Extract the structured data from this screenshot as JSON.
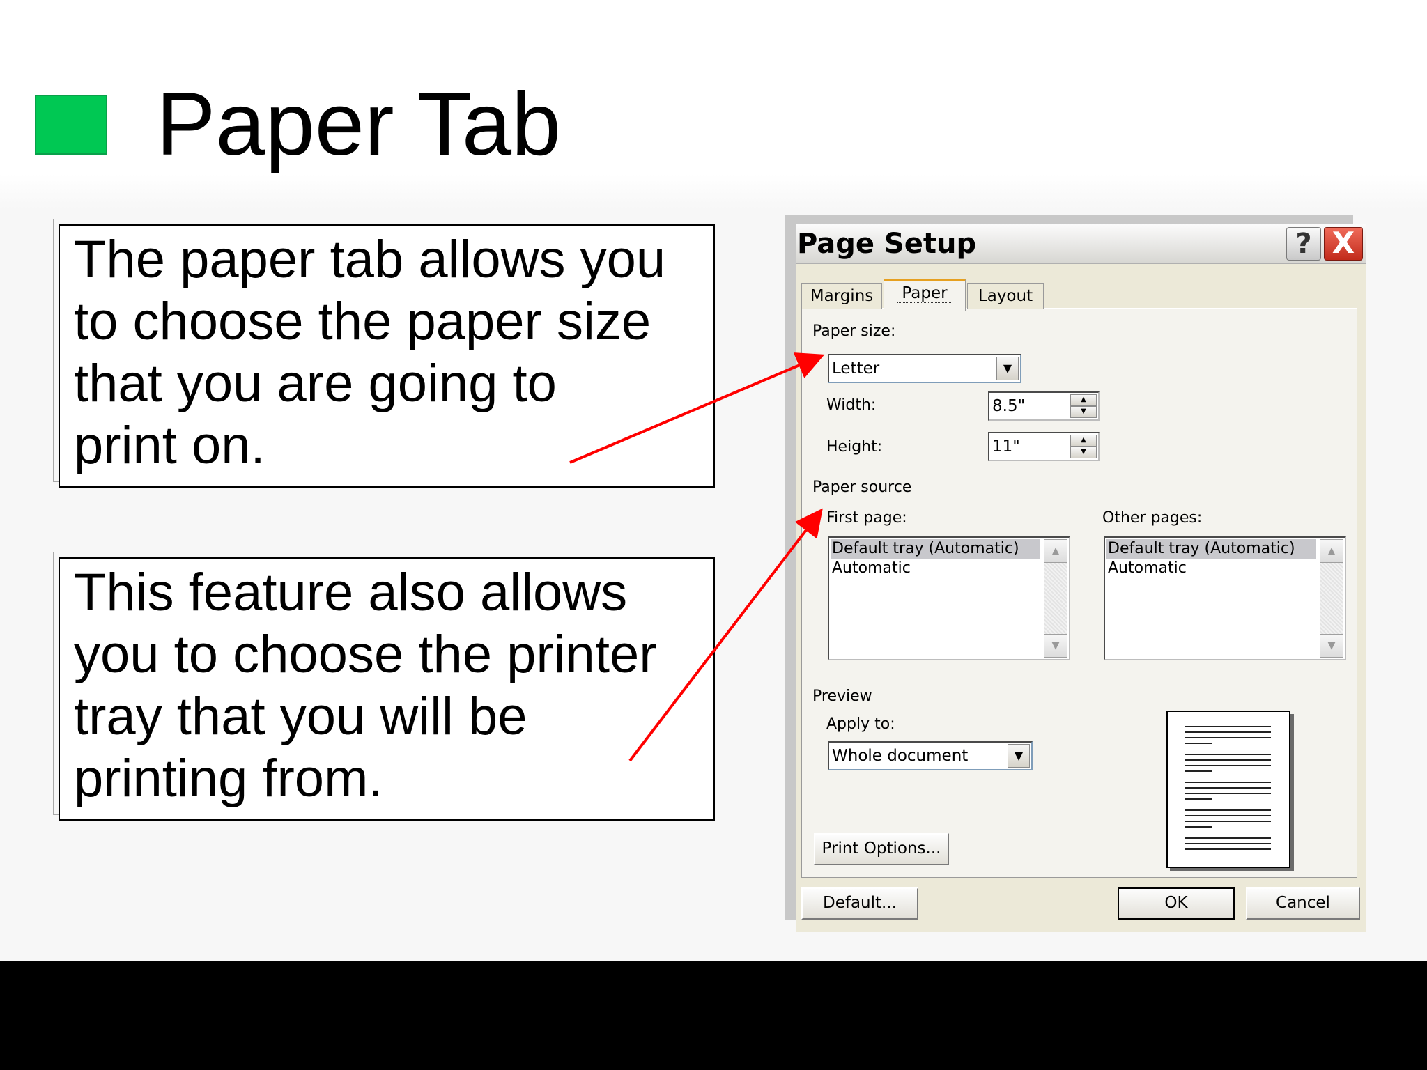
{
  "slide": {
    "title": "Paper Tab",
    "bullet_color": "#00c853",
    "callout1": "The paper tab allows you\nto choose the paper size\nthat you are going to\nprint on.",
    "callout2": "This feature also allows\nyou to choose the printer\ntray that you will be\nprinting from.",
    "arrow_color": "#ff0000"
  },
  "dialog": {
    "title": "Page Setup",
    "help_label": "?",
    "close_label": "X",
    "tabs": [
      "Margins",
      "Paper",
      "Layout"
    ],
    "active_tab": "Paper",
    "paper_size": {
      "label": "Paper size:",
      "value": "Letter",
      "width_label": "Width:",
      "width_value": "8.5\"",
      "height_label": "Height:",
      "height_value": "11\""
    },
    "paper_source": {
      "label": "Paper source",
      "first_page_label": "First page:",
      "first_page_items": [
        "Default tray (Automatic)",
        "Automatic"
      ],
      "other_pages_label": "Other pages:",
      "other_pages_items": [
        "Default tray (Automatic)",
        "Automatic"
      ]
    },
    "preview": {
      "label": "Preview",
      "apply_to_label": "Apply to:",
      "apply_to_value": "Whole document"
    },
    "buttons": {
      "print_options": "Print Options...",
      "default": "Default...",
      "ok": "OK",
      "cancel": "Cancel"
    }
  }
}
